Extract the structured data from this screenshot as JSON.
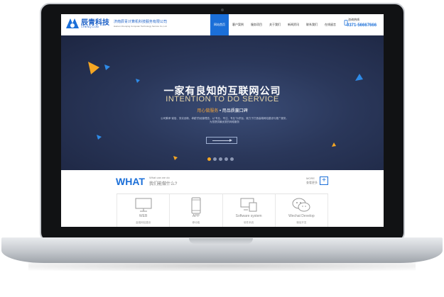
{
  "header": {
    "brand": "辰青科技",
    "brand_sub": "CHENQ.COM",
    "tagline": "济南辰青计算机科技服务有限公司",
    "tagline_en": "Hainan Chenqing Computer Technology Service Co.,Ltd",
    "phone_label": "咨询热线",
    "phone": "0371-56667666"
  },
  "nav": [
    {
      "label": "网站首页",
      "active": true
    },
    {
      "label": "客户案例"
    },
    {
      "label": "服务项目"
    },
    {
      "label": "关于我们"
    },
    {
      "label": "新闻资讯"
    },
    {
      "label": "联系我们"
    },
    {
      "label": "在线留言"
    }
  ],
  "banner": {
    "title_cn": "一家有良知的互联网公司",
    "title_en": "INTENTION TO DO SERVICE",
    "slogan_highlight": "用心做服务",
    "slogan_rest": " • 用品质赢口碑",
    "description": "公司秉承“诚信、务实创新、卓越”的经营理念，以“专业、专注、专业”为宗旨，致力于打造高端网站建设与推广服务，为您提供最优质的网络服务"
  },
  "what": {
    "title": "WHAT",
    "sub_en": "What can we do",
    "sub_cn": "我们能做什么?",
    "more_cn": "查看更多",
    "more_en": "MORE"
  },
  "services": [
    {
      "name": "WEB",
      "cn": "高端网站建设",
      "icon": "monitor-icon"
    },
    {
      "name": "APP",
      "cn": "移动端",
      "icon": "phone-icon"
    },
    {
      "name": "Software system",
      "cn": "软件系统",
      "icon": "devices-icon"
    },
    {
      "name": "Wechat Develop",
      "cn": "微信开发",
      "icon": "wechat-icon"
    }
  ],
  "colors": {
    "accent": "#1b6fd8",
    "banner": "#2a375a",
    "highlight": "#f5a623"
  }
}
